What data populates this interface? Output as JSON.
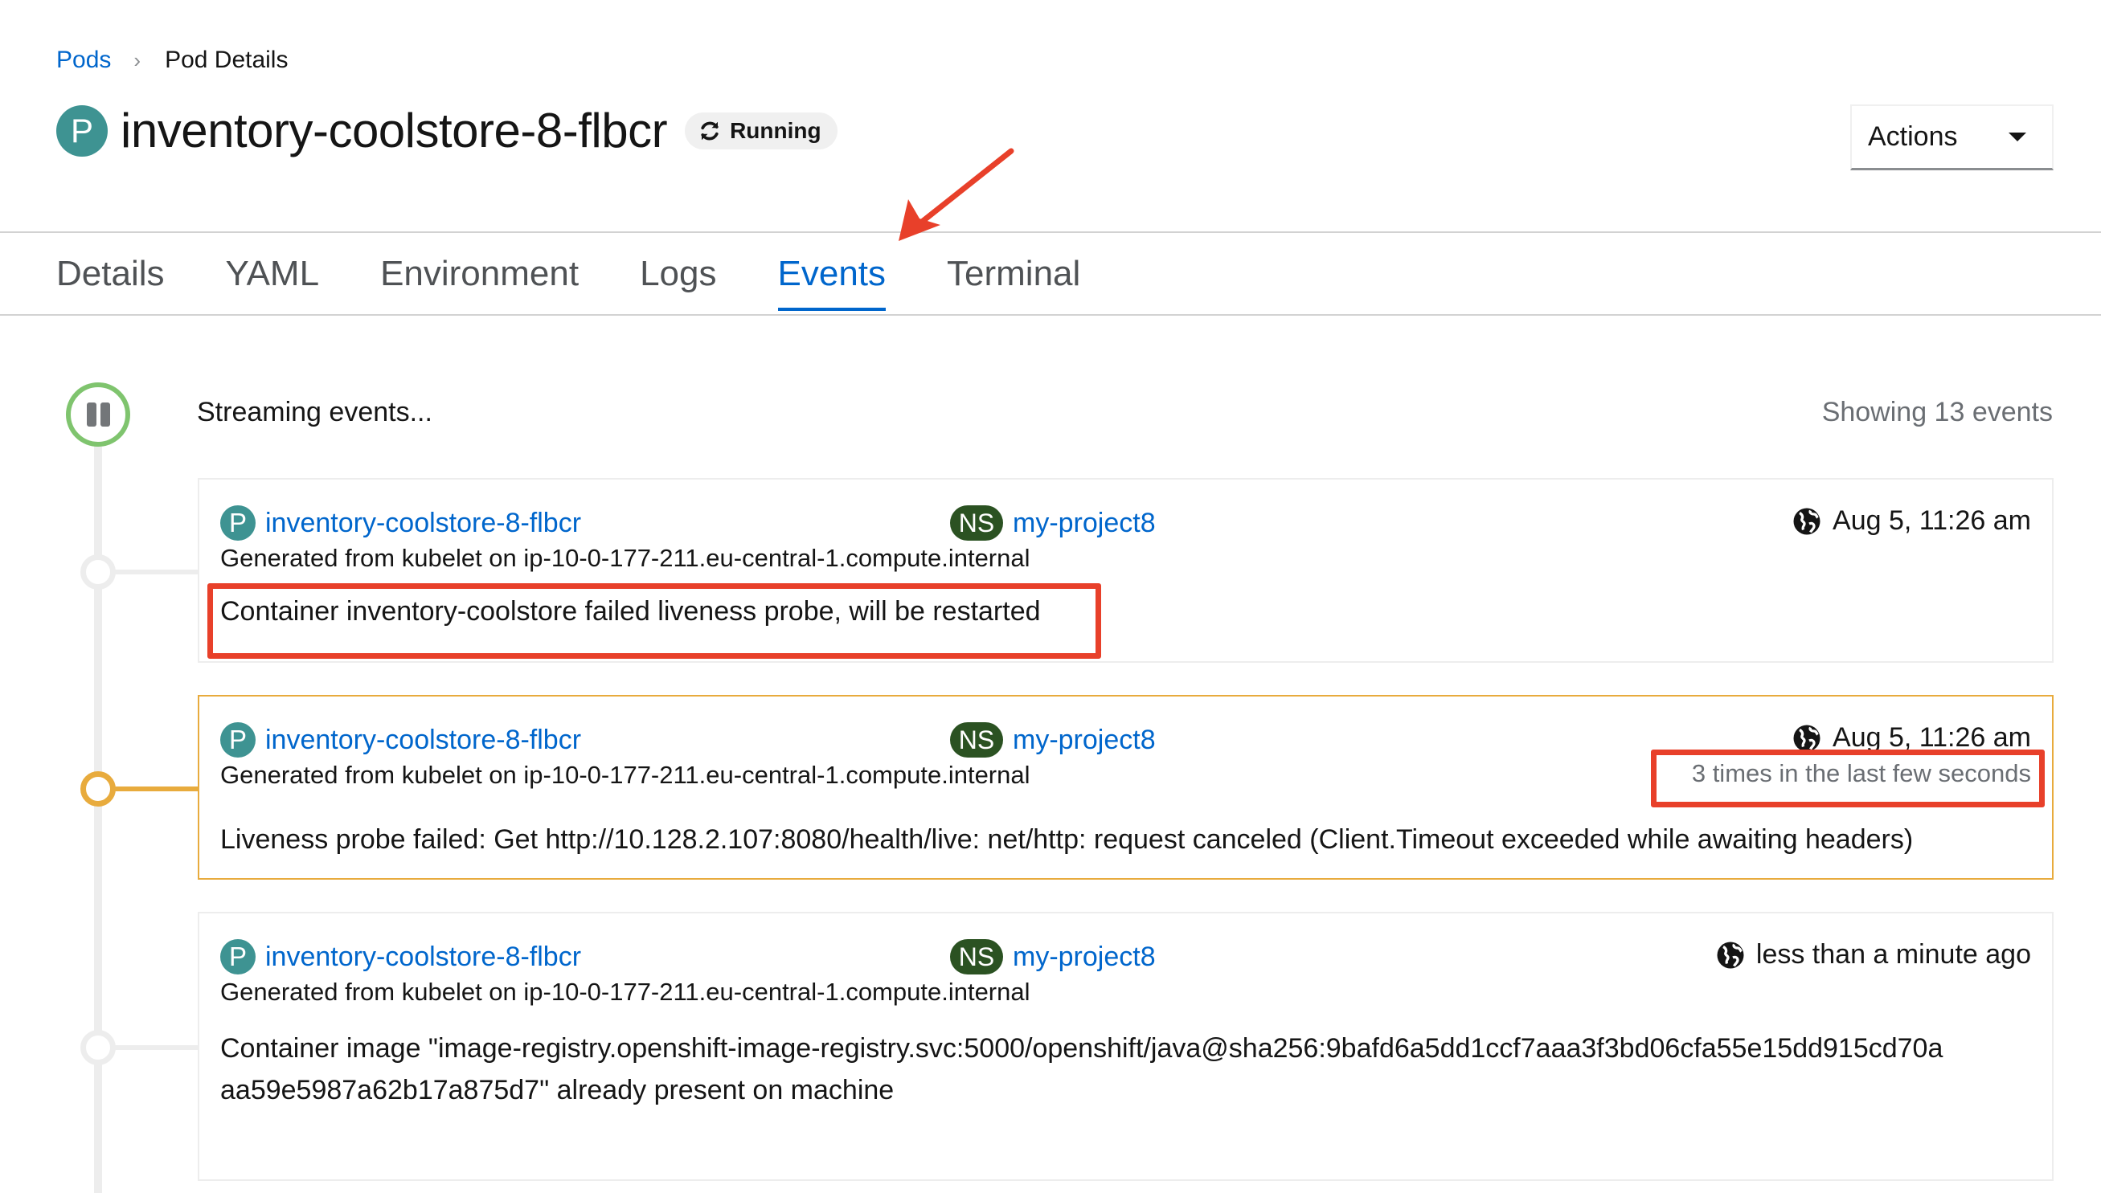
{
  "breadcrumb": {
    "parent": "Pods",
    "separator": "›",
    "current": "Pod Details"
  },
  "header": {
    "resource_badge": "P",
    "title": "inventory-coolstore-8-flbcr",
    "status": "Running",
    "status_icon": "sync-icon",
    "actions_label": "Actions"
  },
  "tabs": [
    {
      "label": "Details",
      "active": false
    },
    {
      "label": "YAML",
      "active": false
    },
    {
      "label": "Environment",
      "active": false
    },
    {
      "label": "Logs",
      "active": false
    },
    {
      "label": "Events",
      "active": true
    },
    {
      "label": "Terminal",
      "active": false
    }
  ],
  "events_panel": {
    "streaming_status": "Streaming events...",
    "event_count": "Showing 13 events",
    "events": [
      {
        "type": "normal",
        "resource_badge": "P",
        "resource_name": "inventory-coolstore-8-flbcr",
        "namespace_badge": "NS",
        "namespace": "my-project8",
        "timestamp": "Aug 5, 11:26 am",
        "source": "Generated from kubelet on ip-10-0-177-211.eu-central-1.compute.internal",
        "count": "",
        "message": "Container inventory-coolstore failed liveness probe, will be restarted"
      },
      {
        "type": "warning",
        "resource_badge": "P",
        "resource_name": "inventory-coolstore-8-flbcr",
        "namespace_badge": "NS",
        "namespace": "my-project8",
        "timestamp": "Aug 5, 11:26 am",
        "source": "Generated from kubelet on ip-10-0-177-211.eu-central-1.compute.internal",
        "count": "3 times in the last few seconds",
        "message": "Liveness probe failed: Get http://10.128.2.107:8080/health/live: net/http: request canceled (Client.Timeout exceeded while awaiting headers)"
      },
      {
        "type": "normal",
        "resource_badge": "P",
        "resource_name": "inventory-coolstore-8-flbcr",
        "namespace_badge": "NS",
        "namespace": "my-project8",
        "timestamp": "less than a minute ago",
        "source": "Generated from kubelet on ip-10-0-177-211.eu-central-1.compute.internal",
        "count": "",
        "message": "Container image \"image-registry.openshift-image-registry.svc:5000/openshift/java@sha256:9bafd6a5dd1ccf7aaa3f3bd06cfa55e15dd915cd70aaa59e5987a62b17a875d7\" already present on machine"
      }
    ]
  },
  "colors": {
    "link": "#0066cc",
    "pod_badge": "#3e9392",
    "namespace_badge": "#2b5222",
    "warning": "#e8ab3d",
    "streaming": "#7fc46e",
    "annotation": "#e8402a"
  }
}
